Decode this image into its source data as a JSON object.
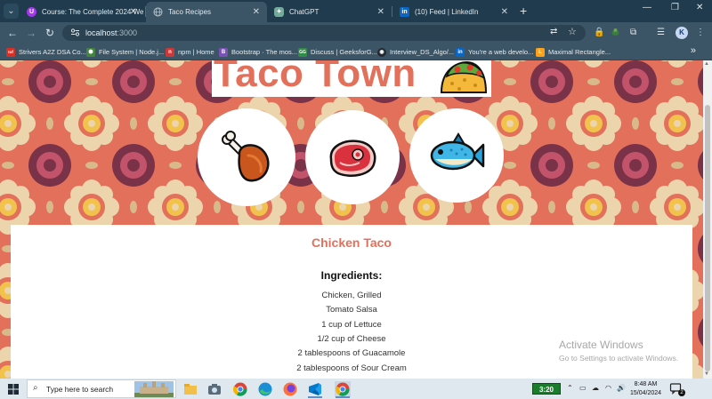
{
  "browser": {
    "tabs": [
      {
        "title": "Course: The Complete 2024 We",
        "icon": "udemy-icon",
        "color": "#a435f0",
        "glyph": "U"
      },
      {
        "title": "Taco Recipes",
        "icon": "globe-icon",
        "color": "#7c8b94",
        "glyph": ""
      },
      {
        "title": "ChatGPT",
        "icon": "chatgpt-icon",
        "color": "#74aa9c",
        "glyph": "✦"
      },
      {
        "title": "(10) Feed | LinkedIn",
        "icon": "linkedin-icon",
        "color": "#0a66c2",
        "glyph": "in"
      }
    ],
    "new_tab": "+",
    "address": {
      "host": "localhost",
      "port": ":3000"
    },
    "profile_initial": "K",
    "bookmarks": [
      {
        "label": "Strivers A2Z DSA Co...",
        "color": "#d93025",
        "glyph": "tuf"
      },
      {
        "label": "File System | Node.j...",
        "color": "#43853d",
        "glyph": "⬢"
      },
      {
        "label": "npm | Home",
        "color": "#cb3837",
        "glyph": "n"
      },
      {
        "label": "Bootstrap · The mos...",
        "color": "#7952b3",
        "glyph": "B"
      },
      {
        "label": "Discuss | GeeksforG...",
        "color": "#2f8d46",
        "glyph": "GG"
      },
      {
        "label": "Interview_DS_Algo/...",
        "color": "#24292f",
        "glyph": "◉"
      },
      {
        "label": "You're a web develo...",
        "color": "#0a66c2",
        "glyph": "in"
      },
      {
        "label": "Maximal Rectangle...",
        "color": "#ffa116",
        "glyph": "L"
      }
    ]
  },
  "page": {
    "title": "Taco Town",
    "categories": [
      {
        "label": "chicken",
        "icon": "chicken-leg-icon"
      },
      {
        "label": "beef",
        "icon": "steak-icon"
      },
      {
        "label": "fish",
        "icon": "fish-icon"
      }
    ],
    "recipe": {
      "name": "Chicken Taco",
      "ingredients_heading": "Ingredients:",
      "ingredients": [
        "Chicken, Grilled",
        "Tomato Salsa",
        "1 cup of Lettuce",
        "1/2 cup of Cheese",
        "2 tablespoons of Guacamole",
        "2 tablespoons of Sour Cream"
      ]
    },
    "accent_color": "#e2705b"
  },
  "watermark": {
    "line1": "Activate Windows",
    "line2": "Go to Settings to activate Windows."
  },
  "taskbar": {
    "search_placeholder": "Type here to search",
    "battery_time": "3:20",
    "time": "8:48 AM",
    "date": "15/04/2024",
    "notification_count": "2"
  }
}
